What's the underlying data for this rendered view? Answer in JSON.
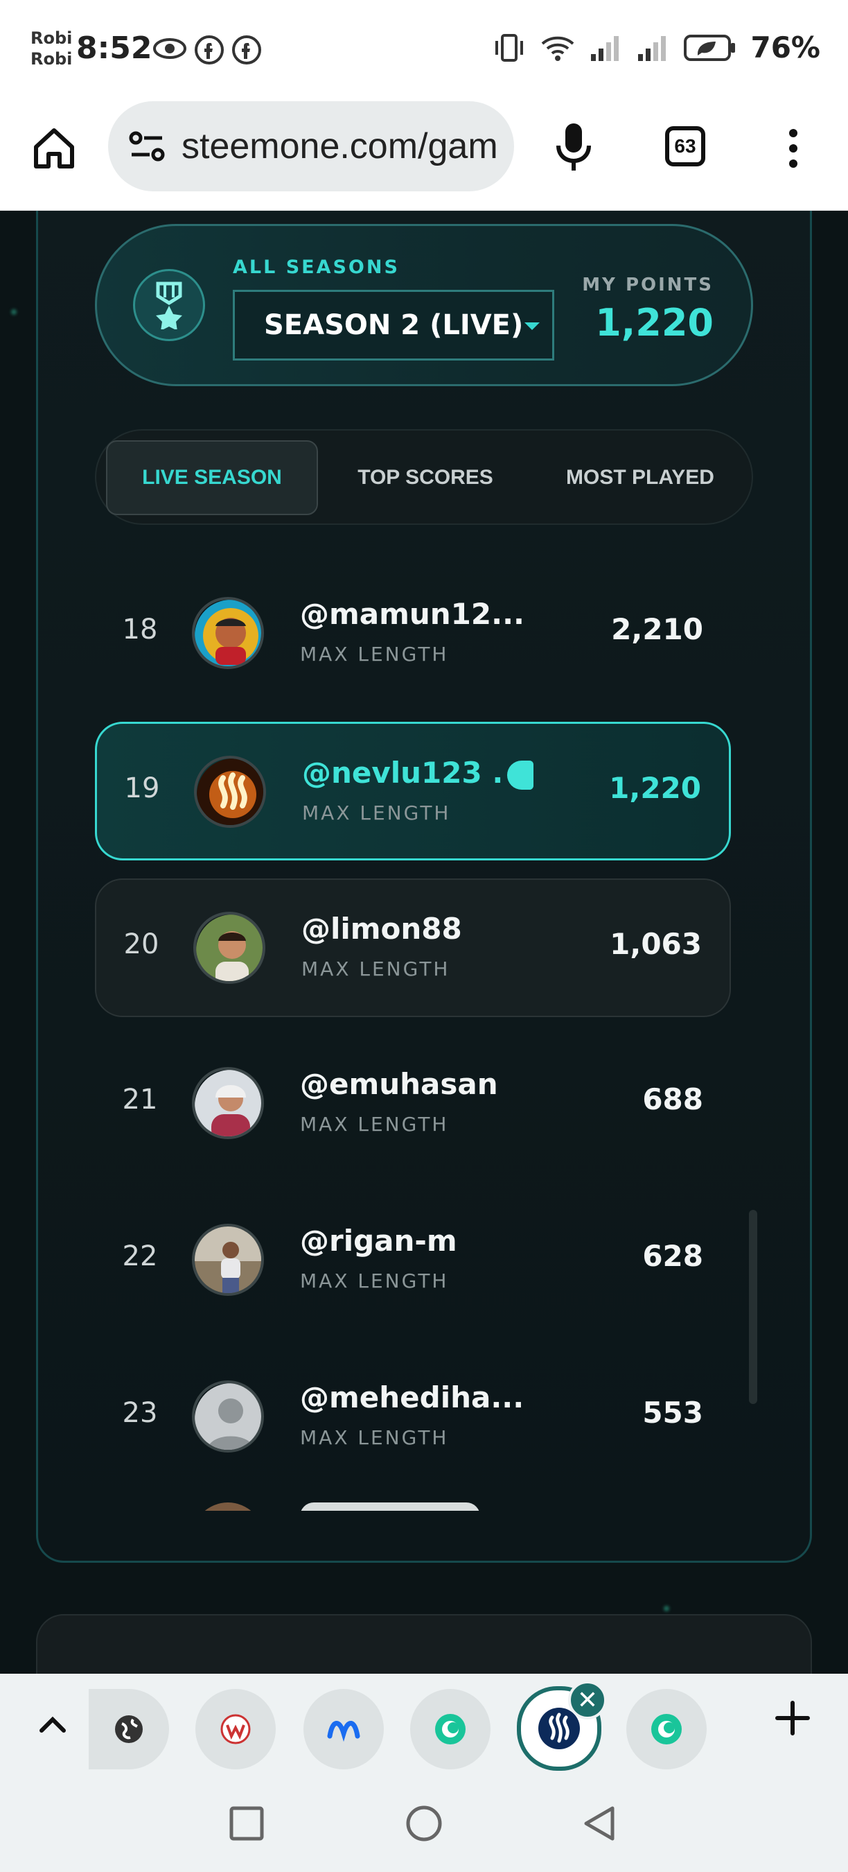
{
  "status": {
    "carrier1": "Robi",
    "carrier2": "Robi",
    "time": "8:52",
    "battery": "76%"
  },
  "browser": {
    "url": "steemone.com/gam",
    "tab_count": "63"
  },
  "season": {
    "all_seasons_label": "ALL SEASONS",
    "selected": "SEASON 2 (LIVE)",
    "my_points_label": "MY POINTS",
    "my_points": "1,220"
  },
  "tabs": [
    {
      "label": "LIVE SEASON",
      "active": true
    },
    {
      "label": "TOP SCORES",
      "active": false
    },
    {
      "label": "MOST PLAYED",
      "active": false
    }
  ],
  "leaderboard": [
    {
      "rank": "18",
      "user": "@mamun12...",
      "metric": "MAX LENGTH",
      "score": "2,210"
    },
    {
      "rank": "19",
      "user": "@nevlu123 .",
      "metric": "MAX LENGTH",
      "score": "1,220"
    },
    {
      "rank": "20",
      "user": "@limon88",
      "metric": "MAX LENGTH",
      "score": "1,063"
    },
    {
      "rank": "21",
      "user": "@emuhasan",
      "metric": "MAX LENGTH",
      "score": "688"
    },
    {
      "rank": "22",
      "user": "@rigan-m",
      "metric": "MAX LENGTH",
      "score": "628"
    },
    {
      "rank": "23",
      "user": "@mehediha...",
      "metric": "MAX LENGTH",
      "score": "553"
    }
  ],
  "colors": {
    "accent": "#37d8d0",
    "panel_border": "#16494c",
    "dock_selected": "#1d6e6a"
  },
  "icons": [
    "home-icon",
    "tune-icon",
    "mic-icon",
    "tabs-icon",
    "menu-icon",
    "medal-icon",
    "chevron-up-icon",
    "plus-icon",
    "close-icon"
  ]
}
